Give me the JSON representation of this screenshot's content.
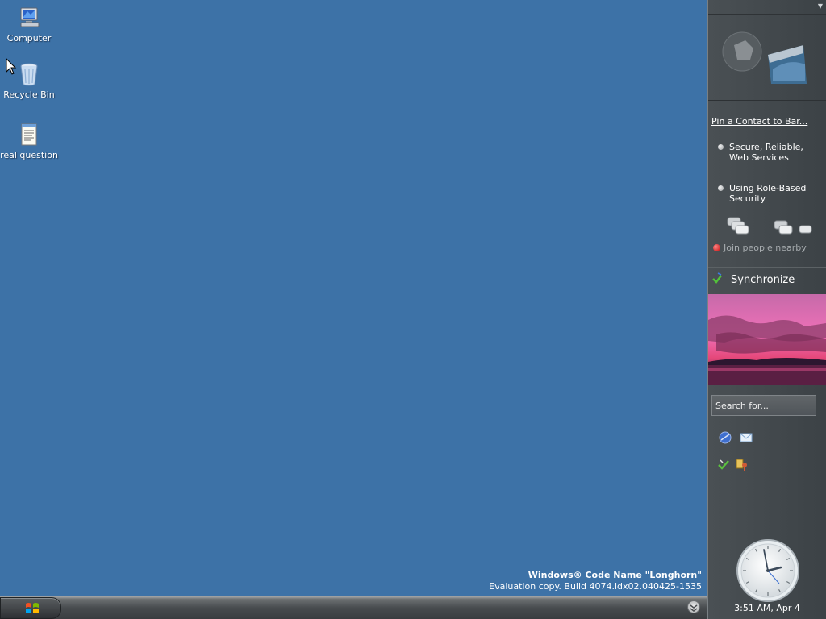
{
  "desktop": {
    "icons": [
      {
        "label": "Computer",
        "icon": "computer-icon"
      },
      {
        "label": "Recycle Bin",
        "icon": "recycle-bin-icon"
      },
      {
        "label": "real question",
        "icon": "text-document-icon"
      }
    ],
    "watermark": {
      "line1": "Windows® Code Name \"Longhorn\"",
      "line2": "Evaluation copy. Build 4074.idx02.040425-1535"
    },
    "background_color": "#3d72a7"
  },
  "taskbar": {
    "start_icon": "windows-flag-icon",
    "tray_icon": "chevron-down-icon"
  },
  "sidebar": {
    "pin_contact": "Pin a Contact to Bar...",
    "news": [
      {
        "line1": "Secure, Reliable,",
        "line2": "Web Services"
      },
      {
        "line1": "Using Role-Based",
        "line2": "Security"
      }
    ],
    "join_people": "Join people nearby",
    "synchronize": "Synchronize",
    "search_placeholder": "Search for...",
    "clock_time": "3:51 AM, Apr 4"
  }
}
